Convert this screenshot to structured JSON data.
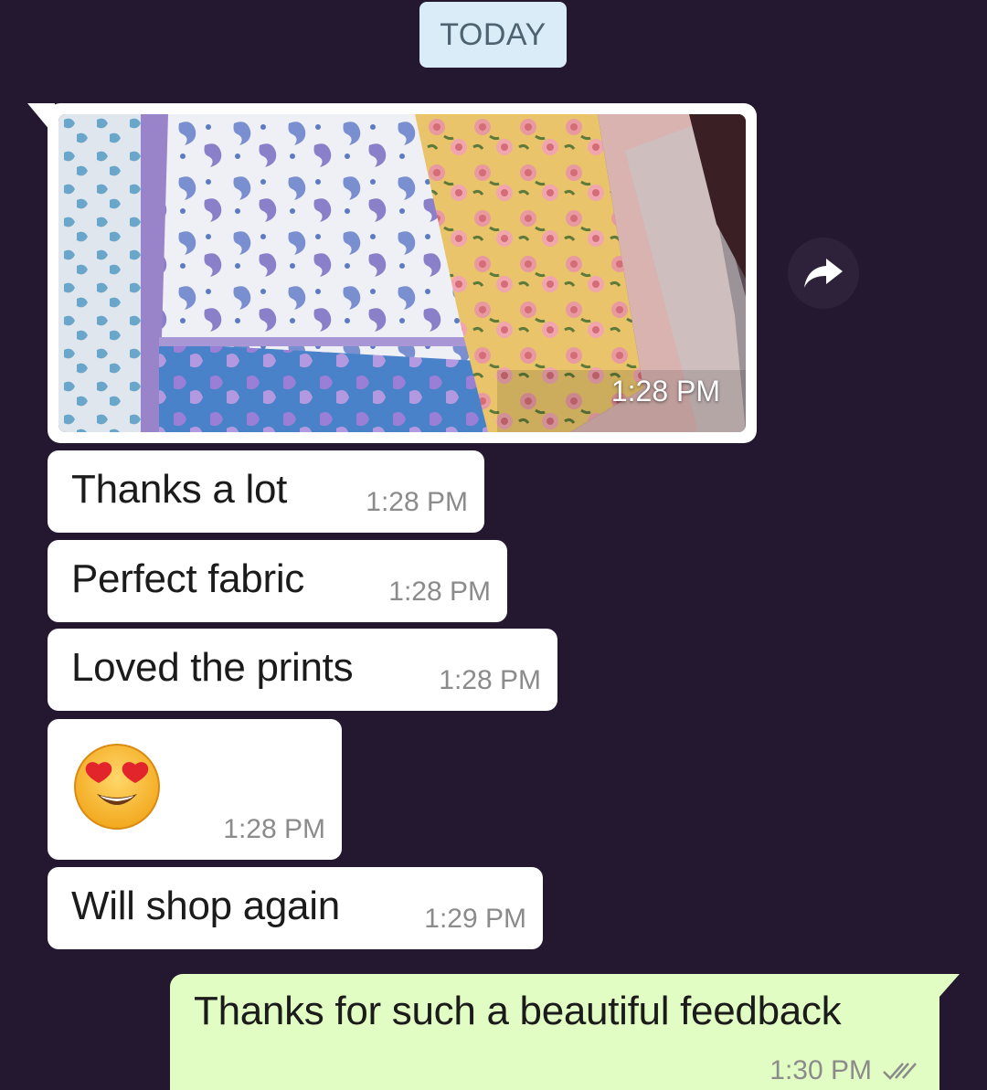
{
  "date_chip": {
    "label": "TODAY"
  },
  "image_message": {
    "time": "1:28 PM",
    "icon": "forward-icon"
  },
  "incoming_messages": [
    {
      "text": "Thanks a lot",
      "time": "1:28 PM"
    },
    {
      "text": "Perfect fabric",
      "time": "1:28 PM"
    },
    {
      "text": "Loved the prints",
      "time": "1:28 PM"
    },
    {
      "emoji": "heart-eyes-emoji",
      "time": "1:28 PM"
    },
    {
      "text": "Will shop again",
      "time": "1:29 PM"
    }
  ],
  "outgoing_message": {
    "text": "Thanks for such a beautiful feedback",
    "time": "1:30 PM",
    "status_icon": "double-check-icon"
  },
  "colors": {
    "background": "#23182f",
    "incoming_bubble": "#ffffff",
    "outgoing_bubble": "#e2fdc4",
    "date_chip": "#d9ecf7",
    "timestamp": "#8b8b8b"
  }
}
